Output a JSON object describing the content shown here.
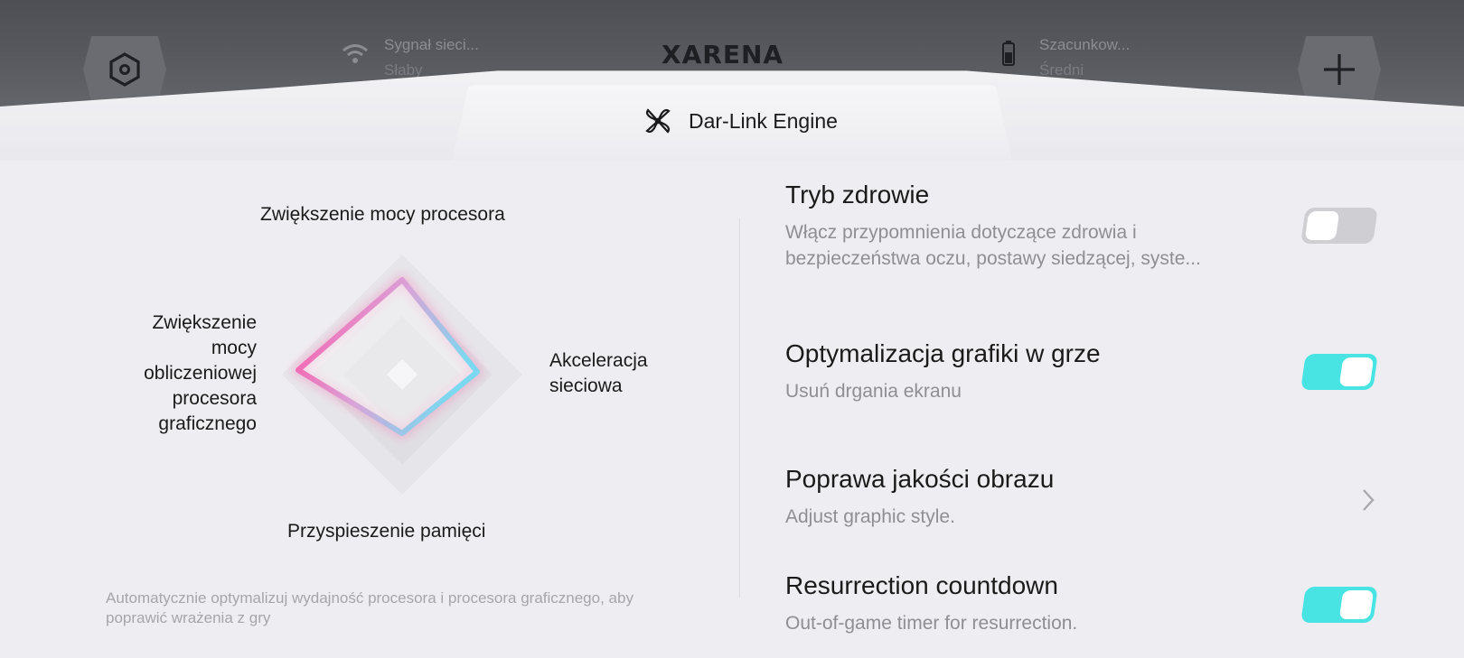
{
  "top_bar": {
    "left_button_icon": "hexagon-settings-icon",
    "signal_label": "Sygnał sieci...",
    "signal_value": "Słaby",
    "logo_text": "ARENA",
    "logo_mark": "X",
    "battery_label": "Szacunkow...",
    "battery_value": "Średni",
    "right_button_icon": "plus-icon"
  },
  "header": {
    "title": "Dar-Link Engine",
    "icon": "propeller-icon"
  },
  "radar": {
    "top_label": "Zwiększenie mocy procesora",
    "left_label_lines": [
      "Zwiększenie",
      "mocy",
      "obliczeniowej",
      "procesora",
      "graficznego"
    ],
    "right_label_lines": [
      "Akceleracja",
      "sieciowa"
    ],
    "bottom_label": "Przyspieszenie pamięci",
    "accent_start": "#ff4fa3",
    "accent_end": "#7ad9f0",
    "note": "Automatycznie optymalizuj wydajność procesora i procesora graficznego, aby poprawić wrażenia z gry"
  },
  "settings": {
    "health": {
      "title": "Tryb zdrowie",
      "desc_line1": "Włącz przypomnienia dotyczące zdrowia i",
      "desc_line2": "bezpieczeństwa oczu, postawy siedzącej, syste...",
      "enabled": false
    },
    "graphics": {
      "title": "Optymalizacja grafiki w grze",
      "desc": "Usuń drgania ekranu",
      "enabled": true
    },
    "image_quality": {
      "title": "Poprawa jakości obrazu",
      "desc": "Adjust graphic style."
    },
    "resurrection": {
      "title": "Resurrection countdown",
      "desc": "Out-of-game timer for resurrection.",
      "enabled": true
    }
  },
  "colors": {
    "toggle_on": "#48e3e3",
    "toggle_off": "#cfcfd3",
    "top_bar": "#55575d"
  }
}
